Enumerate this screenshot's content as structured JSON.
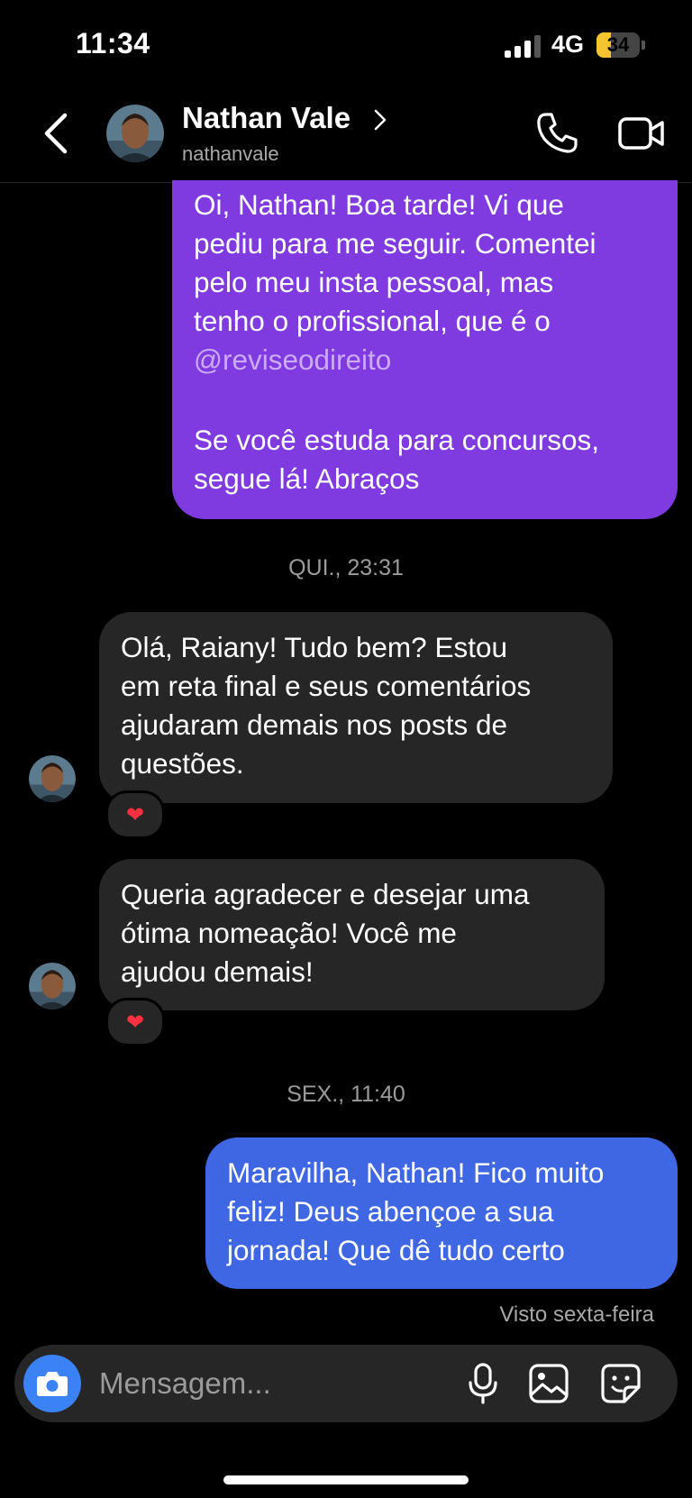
{
  "status_bar": {
    "time": "11:34",
    "network": "4G",
    "battery": "34",
    "battery_level": 0.34
  },
  "header": {
    "name": "Nathan Vale",
    "username": "nathanvale"
  },
  "messages": [
    {
      "direction": "outgoing",
      "lines": [
        "Oi, Nathan! Boa tarde! Vi que",
        "pediu para me seguir. Comentei",
        "pelo meu insta pessoal, mas",
        "tenho o profissional, que é o"
      ],
      "mention": "@reviseodireito",
      "paragraph2": [
        "Se você estuda para concursos,",
        "segue lá! Abraços"
      ]
    },
    {
      "type": "timestamp",
      "text": "QUI., 23:31"
    },
    {
      "direction": "incoming",
      "lines": [
        "Olá, Raiany! Tudo bem? Estou",
        "em reta final e seus comentários",
        "ajudaram demais nos posts de",
        "questões."
      ],
      "reaction": "❤️"
    },
    {
      "direction": "incoming",
      "lines": [
        "Queria agradecer e desejar uma",
        "ótima nomeação! Você me",
        "ajudou demais!"
      ],
      "reaction": "❤️"
    },
    {
      "type": "timestamp",
      "text": "SEX., 11:40"
    },
    {
      "direction": "outgoing",
      "lines": [
        "Maravilha, Nathan! Fico muito",
        "feliz! Deus abençoe a sua",
        "jornada! Que dê tudo certo"
      ]
    }
  ],
  "seen": "Visto sexta-feira",
  "composer": {
    "placeholder": "Mensagem..."
  },
  "colors": {
    "outgoing_purple": "#7f3ae0",
    "outgoing_blue": "#3f67e3",
    "incoming": "#262626",
    "camera_button": "#3b82f6",
    "battery": "#f5c431"
  },
  "icons": [
    "back-arrow-icon",
    "chevron-right-icon",
    "phone-icon",
    "video-camera-icon",
    "camera-icon",
    "microphone-icon",
    "gallery-icon",
    "sticker-icon",
    "heart-icon"
  ]
}
